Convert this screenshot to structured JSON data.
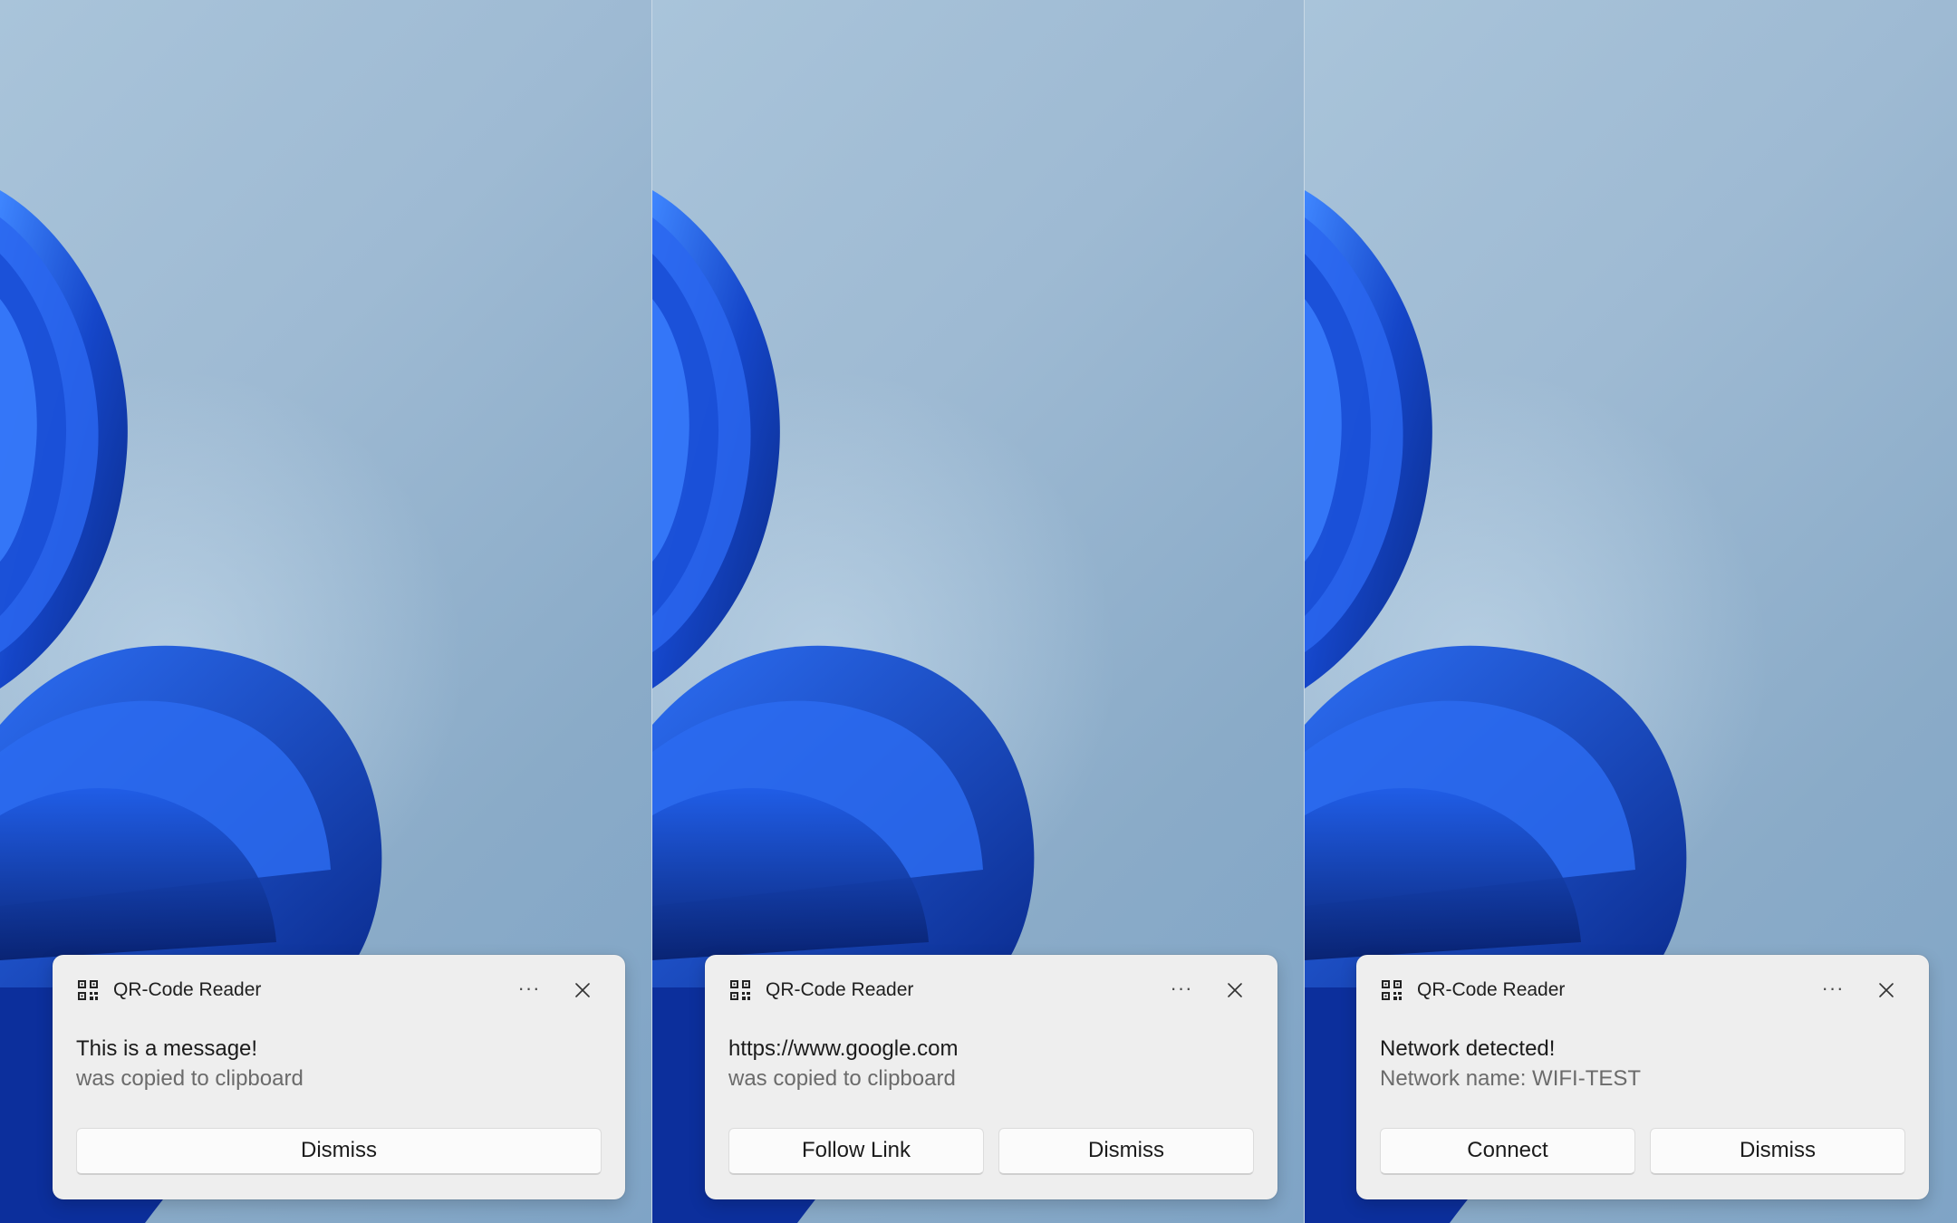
{
  "colors": {
    "toast_background": "#eeeeee",
    "wallpaper_light": "#a9c4da",
    "wallpaper_dark": "#7fa4c6",
    "bloom_blue": "#1a4fd6"
  },
  "toasts": [
    {
      "app_name": "QR-Code Reader",
      "app_icon": "qr-code-icon",
      "more_icon": "more-options-icon",
      "close_icon": "close-icon",
      "title": "This is a message!",
      "subtitle": "was copied to clipboard",
      "actions": [
        "Dismiss"
      ]
    },
    {
      "app_name": "QR-Code Reader",
      "app_icon": "qr-code-icon",
      "more_icon": "more-options-icon",
      "close_icon": "close-icon",
      "title": "https://www.google.com",
      "subtitle": "was copied to clipboard",
      "actions": [
        "Follow Link",
        "Dismiss"
      ]
    },
    {
      "app_name": "QR-Code Reader",
      "app_icon": "qr-code-icon",
      "more_icon": "more-options-icon",
      "close_icon": "close-icon",
      "title": "Network detected!",
      "subtitle": "Network name: WIFI-TEST",
      "actions": [
        "Connect",
        "Dismiss"
      ]
    }
  ]
}
